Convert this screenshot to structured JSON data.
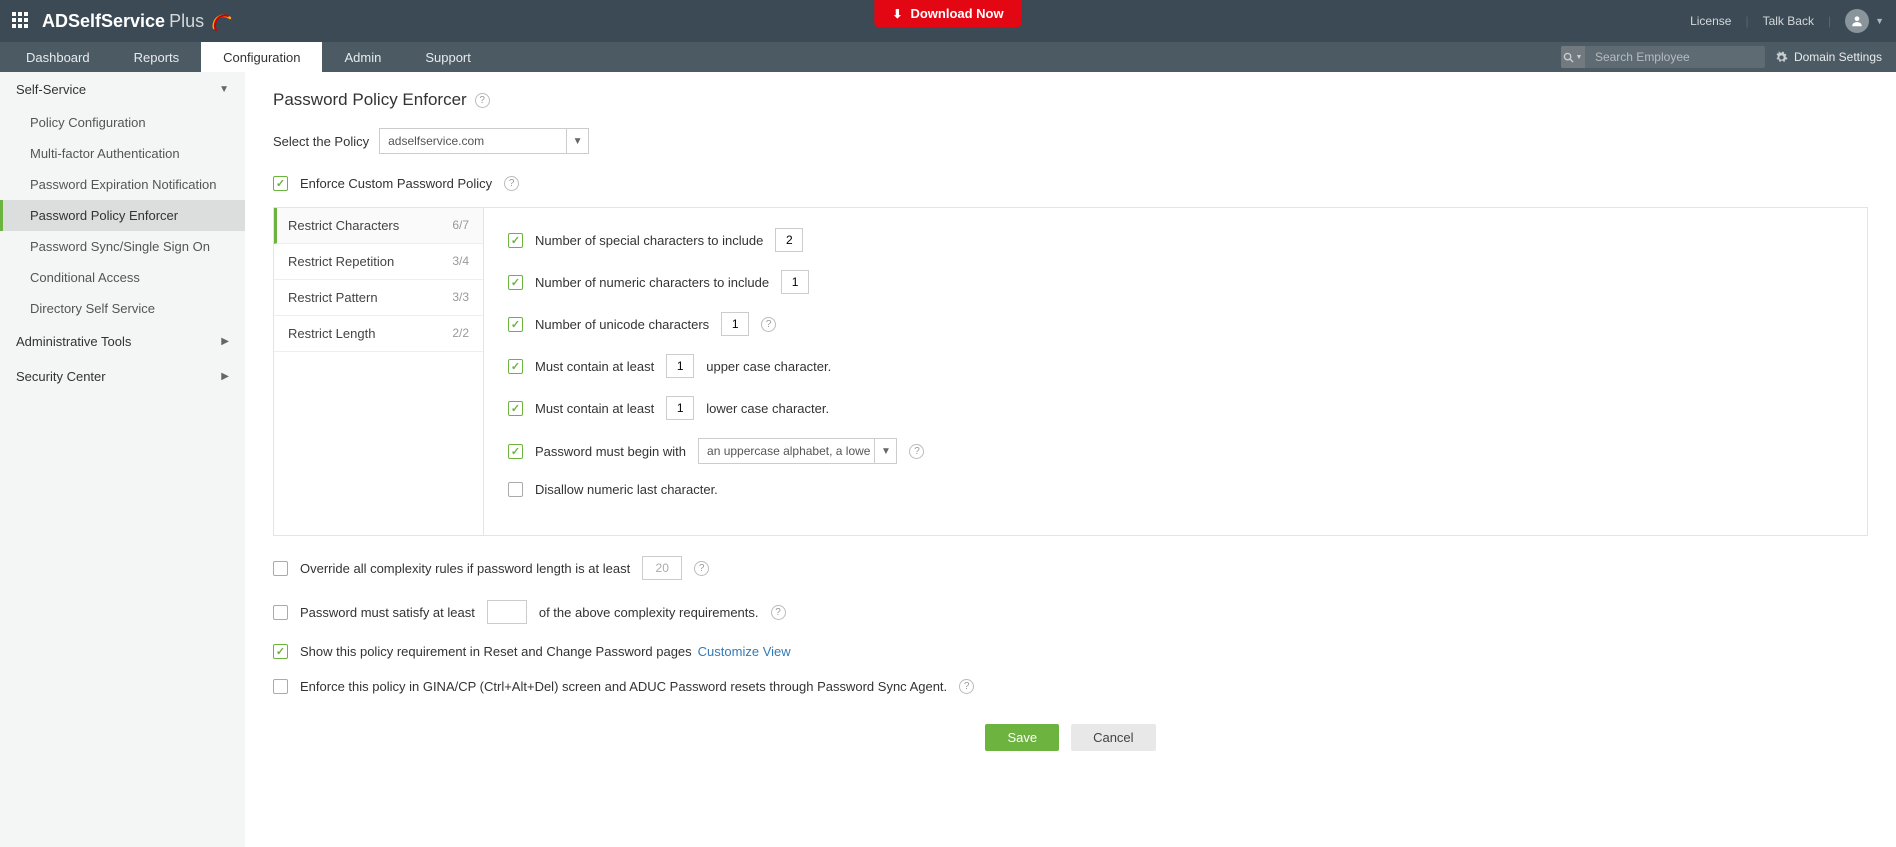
{
  "top": {
    "download": "Download Now",
    "license": "License",
    "talkback": "Talk Back",
    "logo_main": "ADSelfService",
    "logo_plus": "Plus"
  },
  "nav": {
    "tabs": [
      "Dashboard",
      "Reports",
      "Configuration",
      "Admin",
      "Support"
    ],
    "search_placeholder": "Search Employee",
    "domain_settings": "Domain Settings"
  },
  "sidebar": {
    "sections": {
      "self_service": "Self-Service",
      "admin_tools": "Administrative Tools",
      "security_center": "Security Center"
    },
    "items": [
      "Policy Configuration",
      "Multi-factor Authentication",
      "Password Expiration Notification",
      "Password Policy Enforcer",
      "Password Sync/Single Sign On",
      "Conditional Access",
      "Directory Self Service"
    ]
  },
  "page": {
    "title": "Password Policy Enforcer",
    "select_policy_label": "Select the Policy",
    "policy_value": "adselfservice.com",
    "enforce_label": "Enforce Custom Password Policy"
  },
  "ruletabs": [
    {
      "label": "Restrict Characters",
      "count": "6/7"
    },
    {
      "label": "Restrict Repetition",
      "count": "3/4"
    },
    {
      "label": "Restrict Pattern",
      "count": "3/3"
    },
    {
      "label": "Restrict Length",
      "count": "2/2"
    }
  ],
  "rules": {
    "special": {
      "label": "Number of special characters to include",
      "value": "2"
    },
    "numeric": {
      "label": "Number of numeric characters to include",
      "value": "1"
    },
    "unicode": {
      "label": "Number of unicode characters",
      "value": "1"
    },
    "upper_pre": "Must contain at least",
    "upper_val": "1",
    "upper_post": "upper case character.",
    "lower_pre": "Must contain at least",
    "lower_val": "1",
    "lower_post": "lower case character.",
    "begin_label": "Password must begin with",
    "begin_value": "an uppercase alphabet, a lowe",
    "disallow": "Disallow numeric last character."
  },
  "below": {
    "override_pre": "Override all complexity rules if password length is at least",
    "override_val": "20",
    "satisfy_pre": "Password must satisfy at least",
    "satisfy_post": "of the above complexity requirements.",
    "show_policy": "Show this policy requirement in Reset and Change Password pages",
    "customize": "Customize View",
    "gina": "Enforce this policy in GINA/CP (Ctrl+Alt+Del) screen and ADUC Password resets through Password Sync Agent."
  },
  "buttons": {
    "save": "Save",
    "cancel": "Cancel"
  }
}
